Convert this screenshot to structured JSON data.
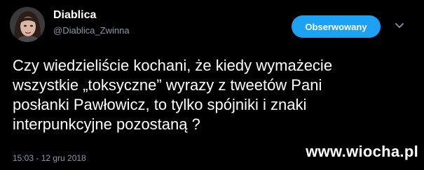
{
  "user": {
    "display_name": "Diablica",
    "handle": "@Diablica_Zwinna",
    "avatar_icon": "profile-photo"
  },
  "actions": {
    "follow_label": "Obserwowany",
    "more_icon": "chevron-down-icon"
  },
  "tweet": {
    "text": "Czy wiedzieliście kochani, że kiedy wymażecie\nwszystkie „toksyczne” wyrazy z tweetów Pani\nposłanki Pawłowicz, to tylko spójniki i znaki\ninterpunkcyjne pozostaną ?",
    "timestamp": "15:03 - 12 gru 2018"
  },
  "watermark": {
    "text": "www.wiocha.pl"
  },
  "colors": {
    "background": "#000000",
    "accent": "#1da1f2",
    "secondary_text": "#8899a6"
  }
}
